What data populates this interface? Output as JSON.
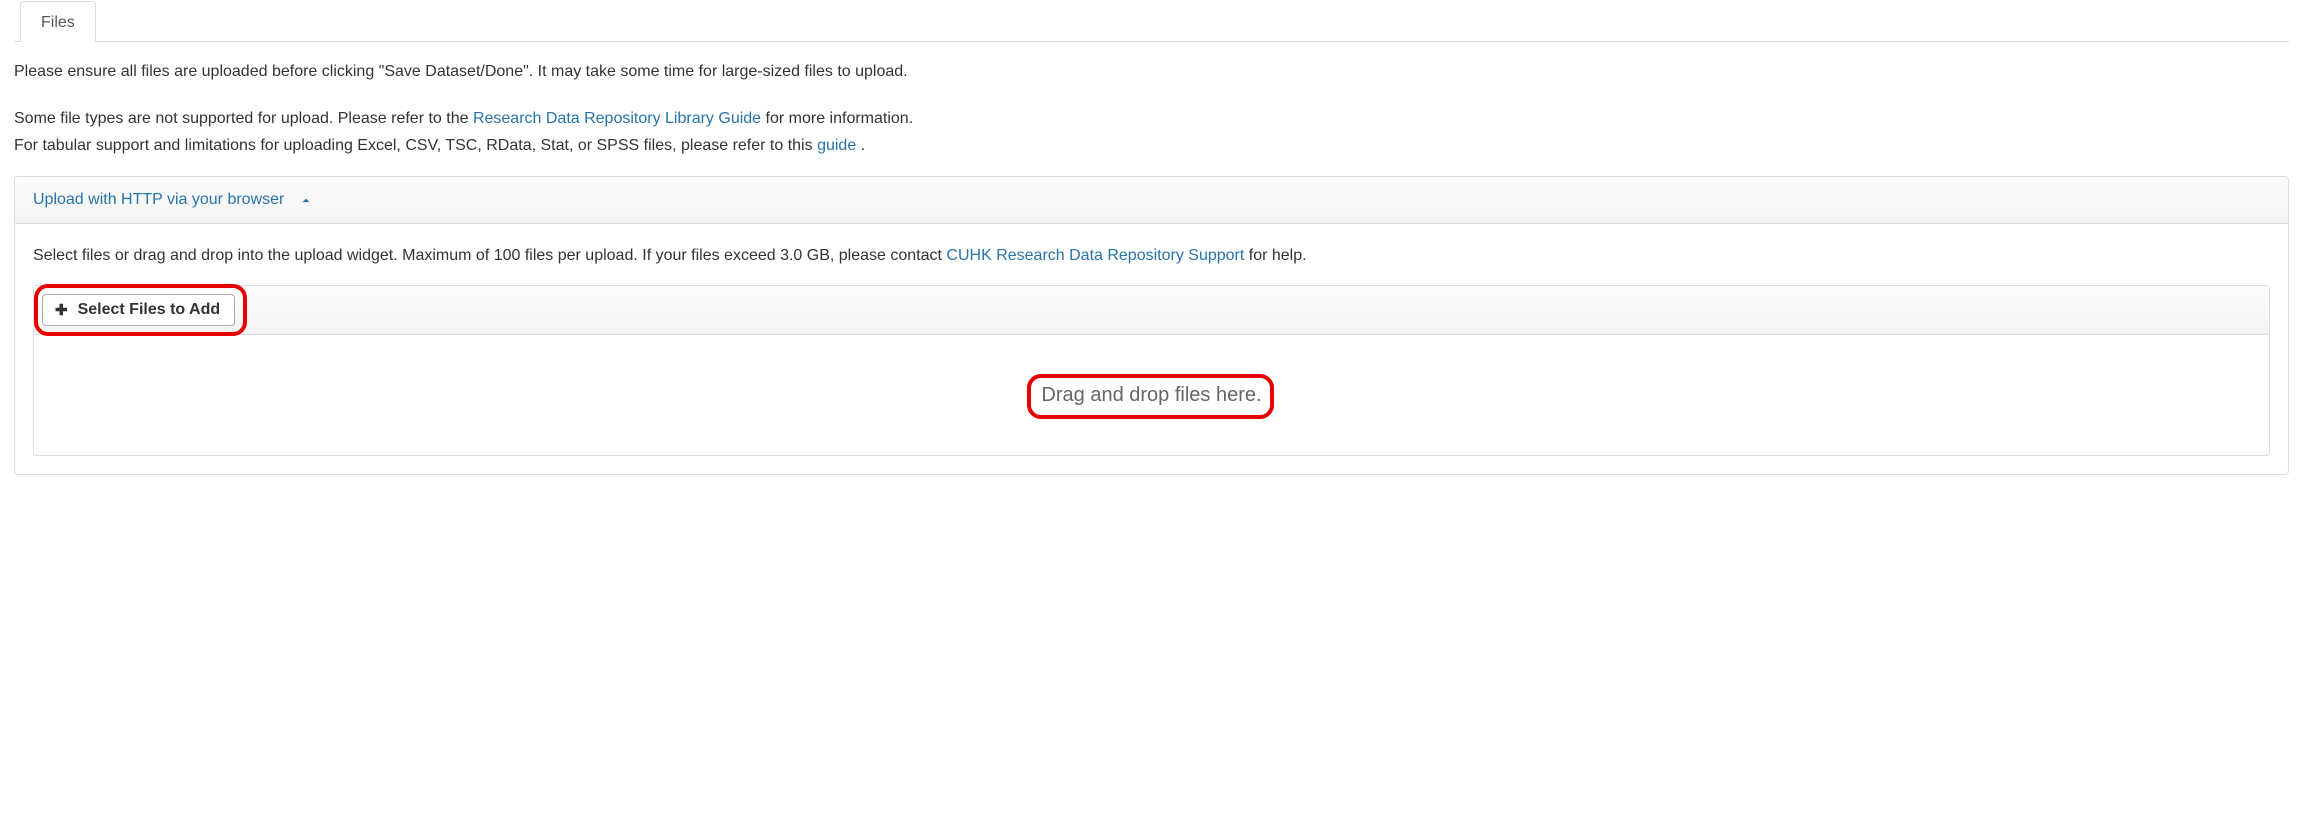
{
  "tabs": {
    "files": "Files"
  },
  "instructions": {
    "line1": "Please ensure all files are uploaded before clicking \"Save Dataset/Done\". It may take some time for large-sized files to upload.",
    "line2_a": "Some file types are not supported for upload. Please refer to the ",
    "line2_link": "Research Data Repository Library Guide",
    "line2_b": " for more information.",
    "line3_a": "For tabular support and limitations for uploading Excel, CSV, TSC, RData, Stat, or SPSS files, please refer to this ",
    "line3_link": "guide",
    "line3_b": "."
  },
  "uploadPanel": {
    "header": "Upload with HTTP via your browser",
    "body_a": "Select files or drag and drop into the upload widget. Maximum of 100 files per upload. If your files exceed 3.0 GB, please contact ",
    "body_link": "CUHK Research Data Repository Support",
    "body_b": " for help.",
    "selectButton": "Select Files to Add",
    "dropText": "Drag and drop files here."
  }
}
